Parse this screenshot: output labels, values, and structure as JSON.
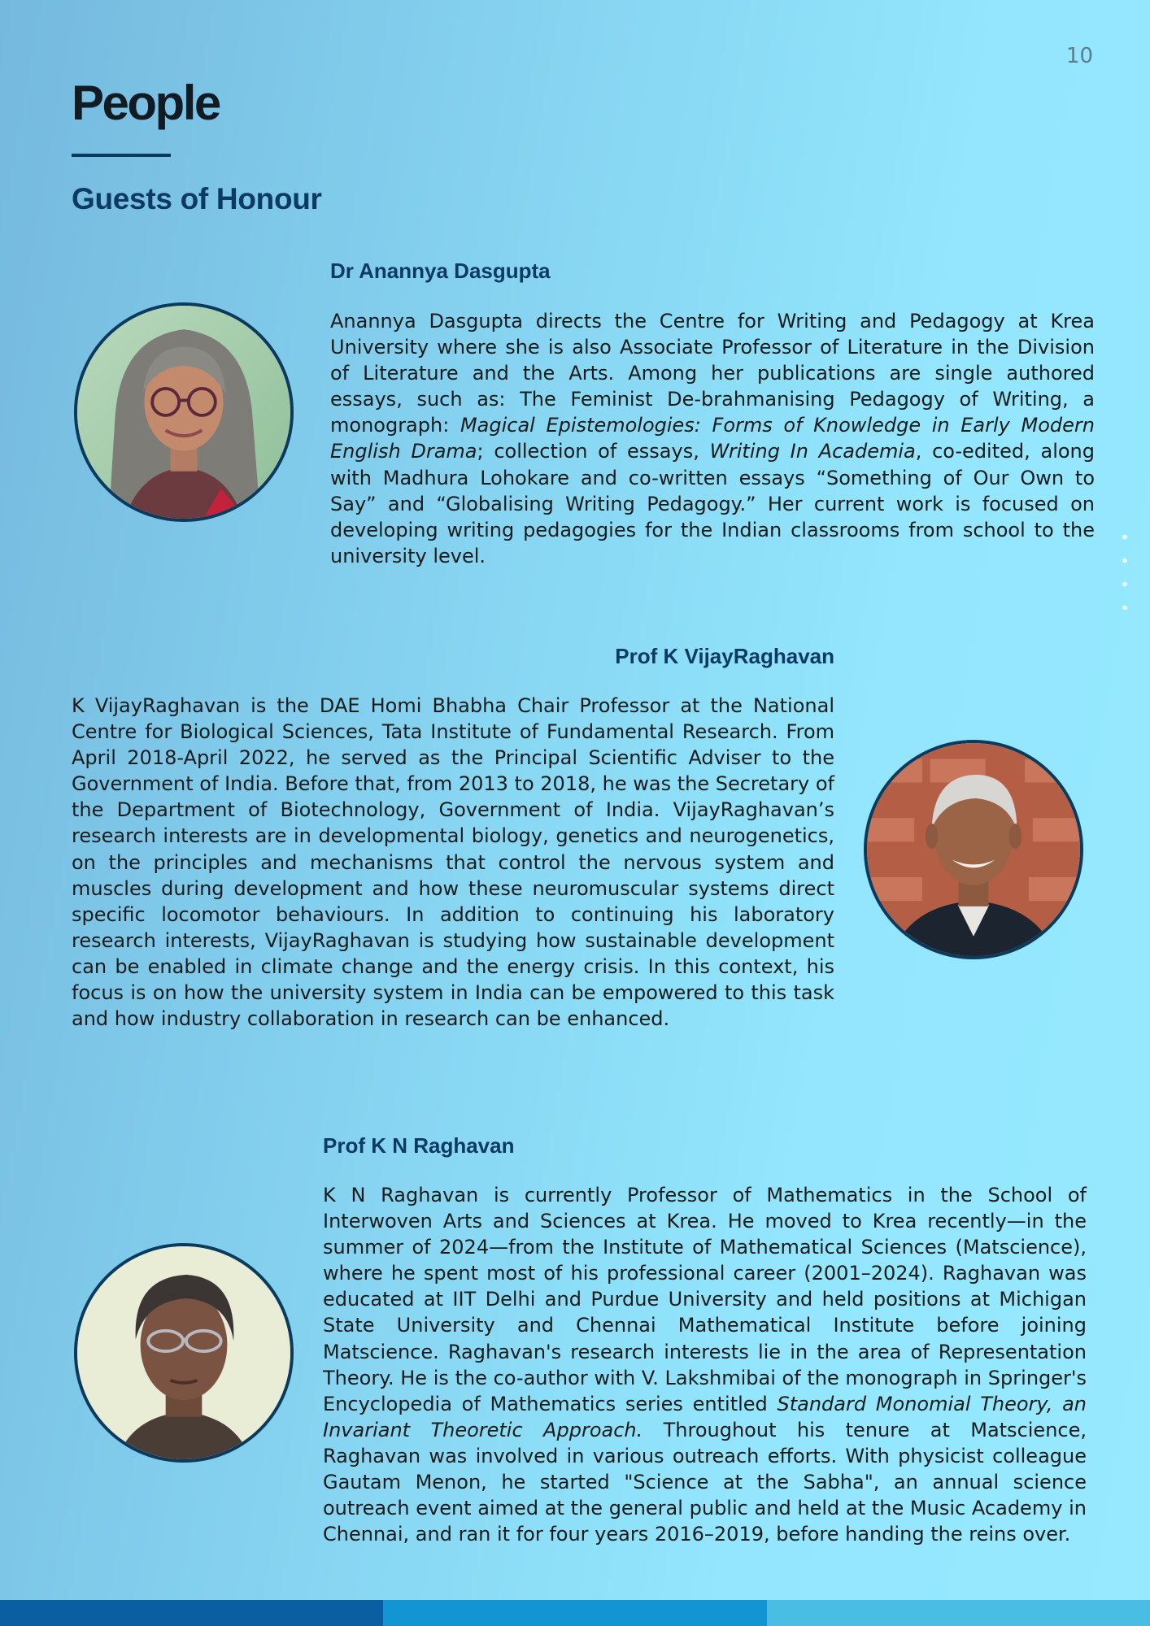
{
  "page": {
    "number": "10",
    "title": "People",
    "section_heading": "Guests of Honour"
  },
  "colors": {
    "navy": "#0d3a62",
    "footer": [
      "#0a5fa2",
      "#1495d3",
      "#49bde3"
    ]
  },
  "people": [
    {
      "name": "Dr Anannya Dasgupta",
      "bio": [
        {
          "text": "Anannya Dasgupta directs the Centre for Writing and Pedagogy at Krea University where she is also Associate Professor of Literature in the Division of Literature and the Arts. Among her publications are single authored essays, such as: The Feminist De-brahmanising Pedagogy of Writing, a monograph: ",
          "italic": false
        },
        {
          "text": "Magical Epistemologies: Forms of Knowledge in Early Modern English Drama",
          "italic": true
        },
        {
          "text": "; collection of essays, ",
          "italic": false
        },
        {
          "text": "Writing In Academia",
          "italic": true
        },
        {
          "text": ", co-edited, along with Madhura Lohokare and co-written essays “Something of Our Own to Say” and “Globalising Writing Pedagogy.” Her current work is focused on developing writing pedagogies for the Indian classrooms from school to the university level.",
          "italic": false
        }
      ]
    },
    {
      "name": "Prof K VijayRaghavan",
      "bio": [
        {
          "text": "K VijayRaghavan is the DAE Homi Bhabha Chair Professor at the National Centre for Biological Sciences, Tata Institute of Fundamental Research. From April 2018-April 2022, he served as the Principal Scientific Adviser to the Government of India. Before that, from 2013 to 2018, he was the Secretary of the Department of Biotechnology, Government of India. VijayRaghavan’s research interests are in developmental biology, genetics and neurogenetics, on the principles and mechanisms that control the nervous system and muscles during development and how these neuromuscular systems direct specific locomotor behaviours. In addition to continuing his laboratory research interests, VijayRaghavan is studying how sustainable development can be enabled in climate change and the energy crisis. In this context, his focus is on how the university system in India can be empowered to this task and how industry collaboration in research can be enhanced.",
          "italic": false
        }
      ]
    },
    {
      "name": "Prof K N Raghavan",
      "bio": [
        {
          "text": "K N Raghavan is currently Professor of Mathematics in the School of Interwoven Arts and Sciences at Krea. He moved to Krea recently—in the summer of 2024—from the Institute of Mathematical Sciences (Matscience), where he spent most of his professional career (2001–2024). Raghavan was educated at IIT Delhi and Purdue University and held positions at Michigan State University and Chennai Mathematical Institute before joining Matscience. Raghavan's research interests lie in the area of Representation Theory. He is the co-author with V. Lakshmibai of the monograph in Springer's Encyclopedia of Mathematics series entitled ",
          "italic": false
        },
        {
          "text": "Standard Monomial Theory, an Invariant Theoretic Approach.",
          "italic": true
        },
        {
          "text": " Throughout his tenure at Matscience, Raghavan was involved in various outreach efforts. With physicist colleague Gautam Menon, he started \"Science at the Sabha\", an annual science outreach event aimed at the general public and held at the Music Academy in Chennai, and ran it for four years 2016–2019, before handing the reins over.",
          "italic": false
        }
      ]
    }
  ]
}
